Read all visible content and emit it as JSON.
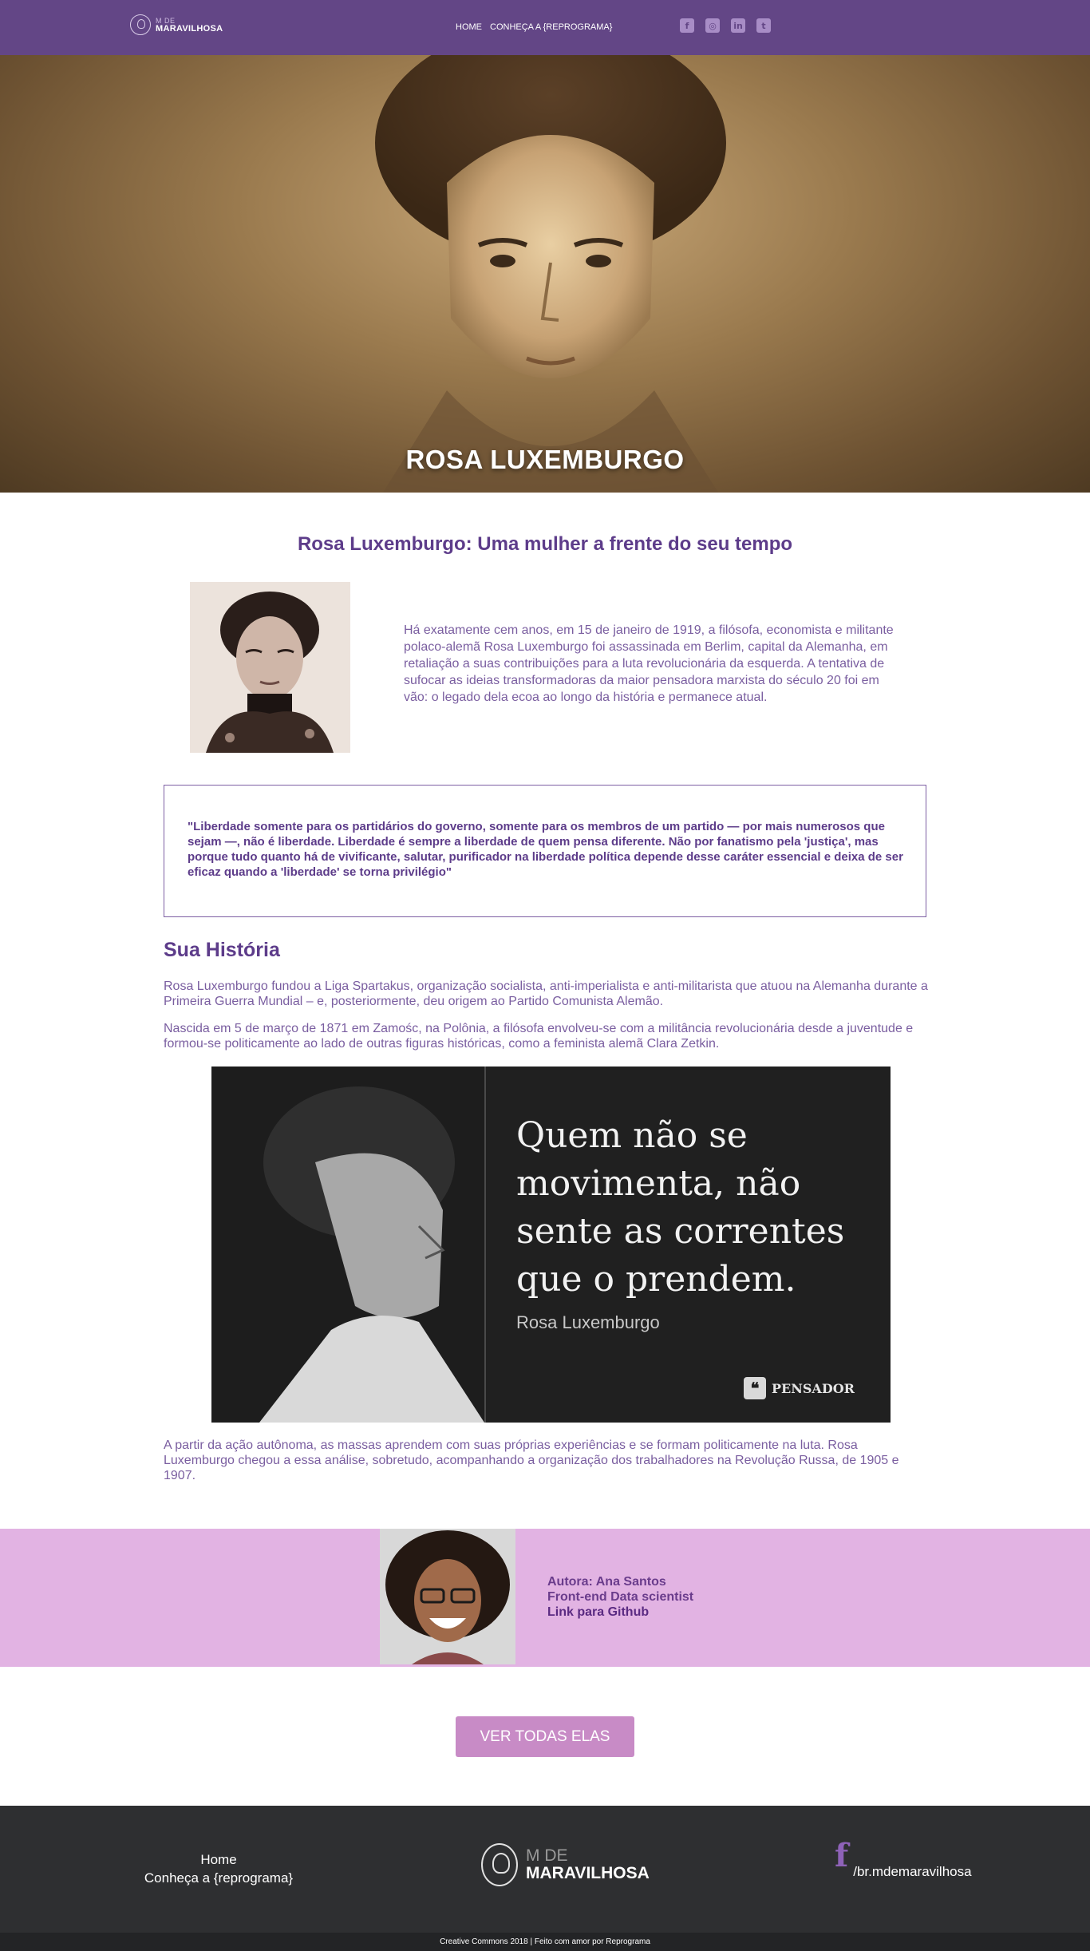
{
  "header": {
    "logo_small": "M DE",
    "logo_big": "MARAVILHOSA",
    "nav": [
      {
        "label": "HOME"
      },
      {
        "label": "CONHEÇA A {REPROGRAMA}"
      }
    ],
    "social": [
      {
        "icon": "facebook-icon",
        "glyph": "f"
      },
      {
        "icon": "instagram-icon",
        "glyph": "◎"
      },
      {
        "icon": "linkedin-icon",
        "glyph": "in"
      },
      {
        "icon": "twitter-icon",
        "glyph": "t"
      }
    ]
  },
  "hero": {
    "title": "ROSA LUXEMBURGO"
  },
  "intro": {
    "title": "Rosa Luxemburgo: Uma mulher a frente do seu tempo",
    "text": "Há exatamente cem anos, em 15 de janeiro de 1919, a filósofa, economista e militante polaco-alemã Rosa Luxemburgo foi assassinada em Berlim, capital da Alemanha, em retaliação a suas contribuições para a luta revolucionária da esquerda. A tentativa de sufocar as ideias transformadoras da maior pensadora marxista do século 20 foi em vão: o legado dela ecoa ao longo da história e permanece atual."
  },
  "quote": {
    "text": "\"Liberdade somente para os partidários do governo, somente para os membros de um partido — por mais numerosos que sejam —, não é liberdade. Liberdade é sempre a liberdade de quem pensa diferente. Não por fanatismo pela 'justiça', mas porque tudo quanto há de vivificante, salutar, purificador na liberdade política depende desse caráter essencial e deixa de ser eficaz quando a 'liberdade' se torna privilégio\""
  },
  "history": {
    "title": "Sua História",
    "p1": "Rosa Luxemburgo fundou a Liga Spartakus, organização socialista, anti-imperialista e anti-militarista que atuou na Alemanha durante a Primeira Guerra Mundial – e, posteriormente, deu origem ao Partido Comunista Alemão.",
    "p2": "Nascida em 5 de março de 1871 em Zamośc, na Polônia, a filósofa envolveu-se com a militância revolucionária desde a juventude e formou-se politicamente ao lado de outras figuras históricas, como a feminista alemã Clara Zetkin.",
    "image_quote": "Quem não se movimenta, não sente as correntes que o prendem.",
    "image_author": "Rosa Luxemburgo",
    "image_brand": "PENSADOR",
    "p3": "A partir da ação autônoma, as massas aprendem com suas próprias experiências e se formam politicamente na luta. Rosa Luxemburgo chegou a essa análise, sobretudo, acompanhando a organização dos trabalhadores na Revolução Russa, de 1905 e 1907."
  },
  "author": {
    "name": "Autora: Ana Santos",
    "role": "Front-end Data scientist",
    "link": "Link para Github"
  },
  "cta": {
    "label": "VER TODAS ELAS"
  },
  "footer": {
    "links": [
      {
        "label": "Home"
      },
      {
        "label": "Conheça a {reprograma}"
      }
    ],
    "logo_small": "M DE",
    "logo_big": "MARAVILHOSA",
    "social_glyph": "f",
    "social_handle": "/br.mdemaravilhosa",
    "copyright": "Creative Commons 2018 | Feito com amor por Reprograma"
  },
  "colors": {
    "header_bg": "#634686",
    "accent_purple": "#5d3c8a",
    "author_band_bg": "#e2b3e3",
    "cta_bg": "#c88bc6",
    "footer_bg": "#2e2f31"
  }
}
